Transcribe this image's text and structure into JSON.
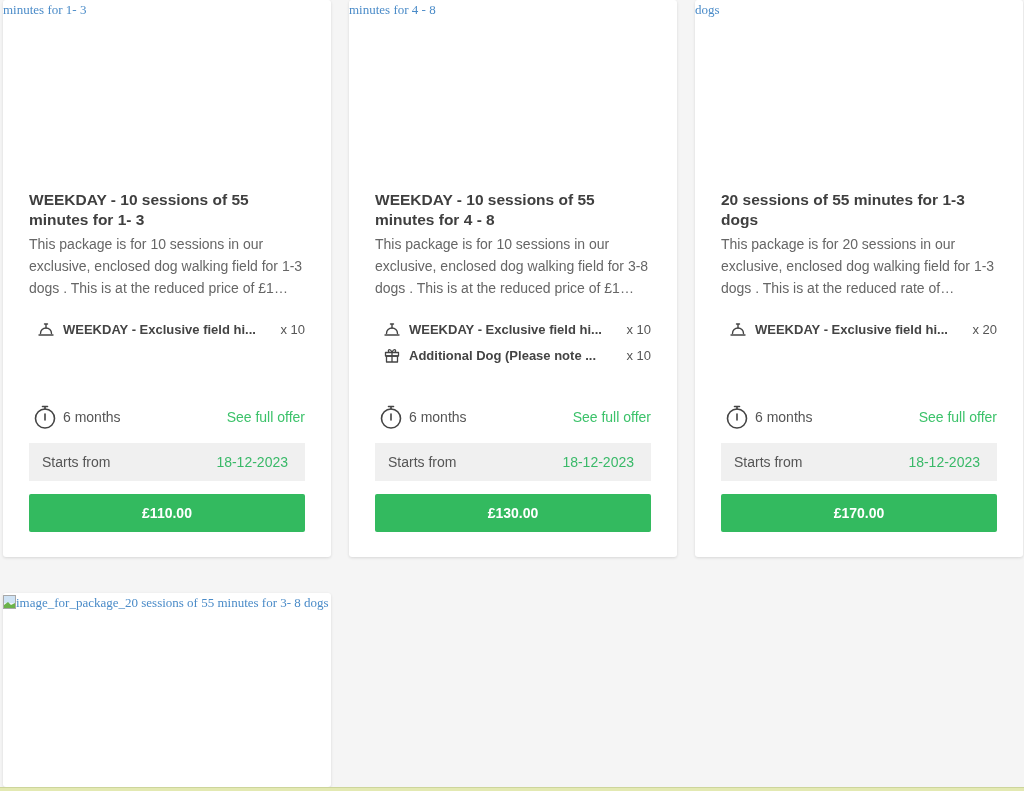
{
  "packages": [
    {
      "image": {
        "alt_text": "minutes for 1- 3"
      },
      "title": "WEEKDAY - 10 sessions of 55 minutes for 1- 3",
      "description": "This package is for 10 sessions in our exclusive, enclosed dog walking field for 1-3 dogs . This is at the reduced price of £1…",
      "items": [
        {
          "kind": "session",
          "name": "WEEKDAY - Exclusive field hi...",
          "quantity": "x 10"
        }
      ],
      "duration": "6 months",
      "offer_link": "See full offer",
      "start_label": "Starts from",
      "start_date": "18-12-2023",
      "price": "£110.00"
    },
    {
      "image": {
        "alt_text": "minutes for 4 - 8"
      },
      "title": "WEEKDAY - 10 sessions of 55 minutes for 4 - 8",
      "description": "This package is for 10 sessions in our exclusive, enclosed dog walking field for 3-8 dogs . This is at the reduced price of £1…",
      "items": [
        {
          "kind": "session",
          "name": "WEEKDAY - Exclusive field hi...",
          "quantity": "x 10"
        },
        {
          "kind": "gift",
          "name": "Additional Dog (Please note ...",
          "quantity": "x 10"
        }
      ],
      "duration": "6 months",
      "offer_link": "See full offer",
      "start_label": "Starts from",
      "start_date": "18-12-2023",
      "price": "£130.00"
    },
    {
      "image": {
        "alt_text": "dogs"
      },
      "title": "20 sessions of 55 minutes for 1-3 dogs",
      "description": "This package is for 20 sessions in our exclusive, enclosed dog walking field for 1-3 dogs . This is at the reduced rate of…",
      "items": [
        {
          "kind": "session",
          "name": "WEEKDAY - Exclusive field hi...",
          "quantity": "x 20"
        }
      ],
      "duration": "6 months",
      "offer_link": "See full offer",
      "start_label": "Starts from",
      "start_date": "18-12-2023",
      "price": "£170.00"
    },
    {
      "image": {
        "alt_text": "image_for_package_20 sessions of 55 minutes for 3- 8 dogs",
        "broken_icon": true
      }
    }
  ]
}
